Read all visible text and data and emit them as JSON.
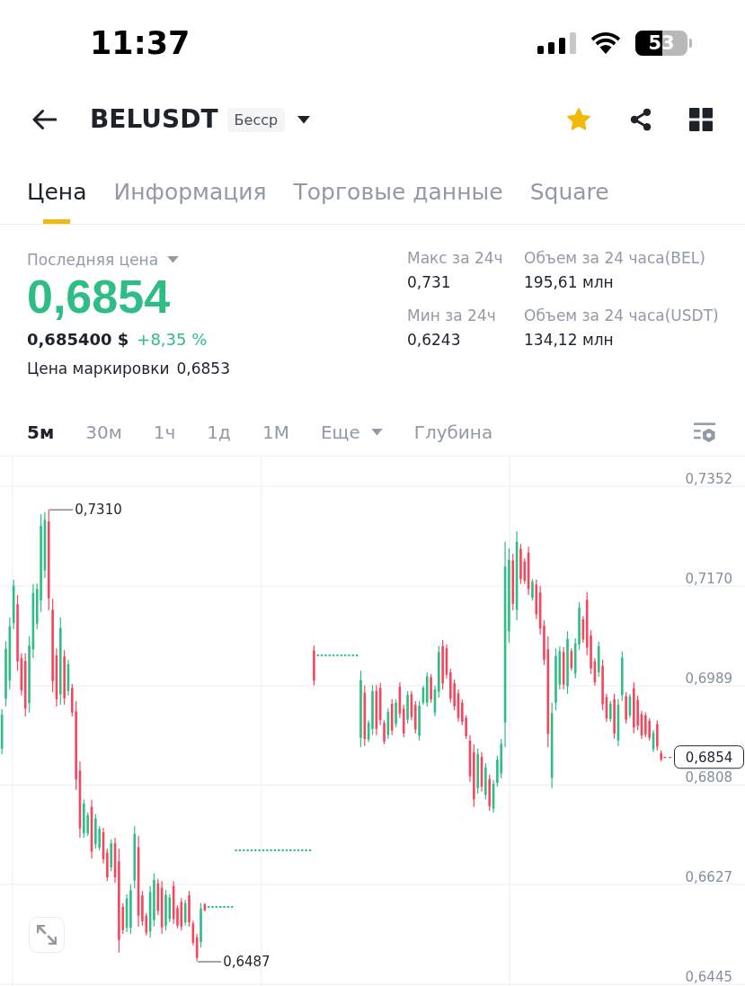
{
  "status_bar": {
    "time": "11:37",
    "battery": "53"
  },
  "header": {
    "title": "BELUSDT",
    "badge": "Бесср",
    "favorite": true
  },
  "tabs": [
    {
      "label": "Цена",
      "selected": true
    },
    {
      "label": "Информация",
      "selected": false
    },
    {
      "label": "Торговые данные",
      "selected": false
    },
    {
      "label": "Square",
      "selected": false
    }
  ],
  "price": {
    "label": "Последняя цена",
    "last": "0,6854",
    "usd": "0,685400 $",
    "change": "+8,35 %",
    "mark_label": "Цена маркировки",
    "mark_value": "0,6853"
  },
  "stats": [
    {
      "label": "Макс за 24ч",
      "value": "0,731"
    },
    {
      "label": "Объем за 24 часа(BEL)",
      "value": "195,61 млн"
    },
    {
      "label": "Мин за 24ч",
      "value": "0,6243"
    },
    {
      "label": "Объем за 24 часа(USDT)",
      "value": "134,12 млн"
    }
  ],
  "intervals": [
    {
      "label": "5м",
      "selected": true,
      "kind": "interval"
    },
    {
      "label": "30м",
      "selected": false,
      "kind": "interval"
    },
    {
      "label": "1ч",
      "selected": false,
      "kind": "interval"
    },
    {
      "label": "1д",
      "selected": false,
      "kind": "interval"
    },
    {
      "label": "1М",
      "selected": false,
      "kind": "interval"
    },
    {
      "label": "Еще",
      "selected": false,
      "kind": "dropdown"
    },
    {
      "label": "Глубина",
      "selected": false,
      "kind": "interval"
    }
  ],
  "chart": {
    "high_marker": "0,7310",
    "low_marker": "0,6487",
    "current_price": "0,6854",
    "chart_data": {
      "type": "candlestick",
      "grid": true,
      "ylim": [
        0.6442,
        0.7406
      ],
      "yticks": [
        {
          "value": 0.7352,
          "label": "0,7352"
        },
        {
          "value": 0.717,
          "label": "0,7170"
        },
        {
          "value": 0.6989,
          "label": "0,6989"
        },
        {
          "value": 0.6808,
          "label": "0,6808"
        },
        {
          "value": 0.6627,
          "label": "0,6627"
        },
        {
          "value": 0.6445,
          "label": "0,6445"
        }
      ],
      "categories": [
        null,
        null,
        null,
        null,
        null,
        null,
        null,
        null,
        null,
        null,
        null,
        null,
        null,
        null,
        null,
        null,
        null,
        null,
        null,
        null,
        null,
        null,
        null,
        null,
        null,
        null,
        null,
        null,
        null,
        null,
        null,
        null,
        null,
        null,
        null,
        null,
        null,
        null,
        null,
        null,
        null,
        null,
        null,
        null,
        null,
        null,
        null,
        null,
        null,
        null,
        null,
        null,
        null,
        null,
        null,
        null,
        null,
        null,
        null,
        null,
        null,
        null,
        null,
        null,
        null,
        null,
        null,
        null,
        null,
        null,
        null,
        null,
        null,
        null,
        null,
        null,
        null,
        null,
        null,
        null,
        null,
        null,
        null,
        null,
        null,
        null,
        null,
        null,
        null,
        null,
        null,
        null,
        null,
        null,
        null,
        null,
        null,
        null,
        null,
        null,
        null,
        null,
        null,
        null,
        null,
        null,
        null,
        null,
        null,
        null,
        null,
        null,
        null,
        null,
        null,
        null,
        null,
        null,
        null,
        null,
        null,
        null,
        null,
        null,
        null,
        null,
        null,
        null,
        null,
        null,
        null,
        null,
        null,
        null,
        null,
        null,
        null,
        null,
        null,
        null,
        null,
        null,
        null,
        null,
        null,
        null,
        null,
        null,
        null,
        null,
        null,
        null,
        null,
        null,
        null,
        null,
        null,
        null,
        null,
        null,
        null,
        null,
        null,
        null,
        null,
        null,
        null,
        null,
        null,
        null,
        null,
        null,
        null,
        null,
        null,
        null,
        null,
        null,
        null,
        null,
        null,
        null,
        null,
        null,
        null,
        null,
        null,
        null,
        null,
        null,
        null
      ],
      "ohlc": [
        [
          0.6874,
          0.6946,
          0.6864,
          0.6936
        ],
        [
          0.6965,
          0.707,
          0.6951,
          0.7056
        ],
        [
          0.6998,
          0.7113,
          0.6982,
          0.7097
        ],
        [
          0.7103,
          0.7182,
          0.7092,
          0.7171
        ],
        [
          0.7137,
          0.7154,
          0.7016,
          0.7033
        ],
        [
          0.7039,
          0.7048,
          0.6971,
          0.698
        ],
        [
          0.7034,
          0.7048,
          0.6933,
          0.6947
        ],
        [
          0.6957,
          0.7079,
          0.694,
          0.7062
        ],
        [
          0.7055,
          0.7174,
          0.7039,
          0.7158
        ],
        [
          0.7102,
          0.7175,
          0.7092,
          0.7165
        ],
        [
          0.7144,
          0.7301,
          0.7123,
          0.728
        ],
        [
          0.7199,
          0.7305,
          0.7185,
          0.7291
        ],
        [
          0.7288,
          0.731,
          0.7126,
          0.7148
        ],
        [
          0.7127,
          0.7147,
          0.6977,
          0.6997
        ],
        [
          0.7044,
          0.7057,
          0.6951,
          0.6964
        ],
        [
          0.6973,
          0.7113,
          0.6954,
          0.7094
        ],
        [
          0.7042,
          0.7054,
          0.6954,
          0.6966
        ],
        [
          0.6979,
          0.7036,
          0.6971,
          0.7028
        ],
        [
          0.6985,
          0.6992,
          0.6933,
          0.694
        ],
        [
          0.6942,
          0.6961,
          0.6799,
          0.6818
        ],
        [
          0.6834,
          0.6851,
          0.6712,
          0.6729
        ],
        [
          0.672,
          0.6782,
          0.6712,
          0.6774
        ],
        [
          0.672,
          0.6758,
          0.6715,
          0.6753
        ],
        [
          0.6768,
          0.6781,
          0.6674,
          0.6687
        ],
        [
          0.67,
          0.6755,
          0.6692,
          0.6747
        ],
        [
          0.6694,
          0.6733,
          0.6689,
          0.6728
        ],
        [
          0.6722,
          0.673,
          0.6665,
          0.6673
        ],
        [
          0.6685,
          0.6692,
          0.6633,
          0.664
        ],
        [
          0.6658,
          0.6709,
          0.6651,
          0.6702
        ],
        [
          0.6702,
          0.6712,
          0.663,
          0.664
        ],
        [
          0.6669,
          0.6692,
          0.6503,
          0.6526
        ],
        [
          0.6586,
          0.6593,
          0.6537,
          0.6544
        ],
        [
          0.6548,
          0.6609,
          0.654,
          0.6601
        ],
        [
          0.6548,
          0.6627,
          0.6537,
          0.6616
        ],
        [
          0.6634,
          0.6733,
          0.662,
          0.6719
        ],
        [
          0.6695,
          0.6715,
          0.655,
          0.657
        ],
        [
          0.6607,
          0.6615,
          0.6552,
          0.656
        ],
        [
          0.657,
          0.6575,
          0.6534,
          0.6539
        ],
        [
          0.6541,
          0.6624,
          0.653,
          0.6613
        ],
        [
          0.6562,
          0.6647,
          0.655,
          0.6635
        ],
        [
          0.6629,
          0.6637,
          0.6571,
          0.6579
        ],
        [
          0.6621,
          0.6633,
          0.6537,
          0.6549
        ],
        [
          0.6552,
          0.6617,
          0.6543,
          0.6608
        ],
        [
          0.6564,
          0.6609,
          0.6558,
          0.6603
        ],
        [
          0.6624,
          0.6633,
          0.6555,
          0.6564
        ],
        [
          0.6584,
          0.6589,
          0.6547,
          0.6552
        ],
        [
          0.6595,
          0.6602,
          0.6543,
          0.655
        ],
        [
          0.6558,
          0.6599,
          0.6552,
          0.6593
        ],
        [
          0.6607,
          0.6615,
          0.655,
          0.6558
        ],
        [
          0.6556,
          0.6561,
          0.6516,
          0.6521
        ],
        [
          0.6531,
          0.6537,
          0.6487,
          0.6493
        ],
        [
          0.6522,
          0.6593,
          0.6512,
          0.6583
        ],
        [
          0.6591,
          0.6593,
          0.6578,
          0.658
        ],
        [
          0.6586,
          0.6586,
          0.6586,
          0.6586
        ],
        [
          0.6586,
          0.6586,
          0.6586,
          0.6586
        ],
        [
          0.6586,
          0.6586,
          0.6586,
          0.6586
        ],
        [
          0.6586,
          0.6586,
          0.6586,
          0.6586
        ],
        [
          0.6586,
          0.6586,
          0.6586,
          0.6586
        ],
        [
          0.6586,
          0.6586,
          0.6586,
          0.6586
        ],
        [
          0.6586,
          0.6586,
          0.6586,
          0.6586
        ],
        [
          0.6689,
          0.6689,
          0.6689,
          0.6689
        ],
        [
          0.6689,
          0.6689,
          0.6689,
          0.6689
        ],
        [
          0.6689,
          0.6689,
          0.6689,
          0.6689
        ],
        [
          0.6689,
          0.6689,
          0.6689,
          0.6689
        ],
        [
          0.6689,
          0.6689,
          0.6689,
          0.6689
        ],
        [
          0.6689,
          0.6689,
          0.6689,
          0.6689
        ],
        [
          0.6689,
          0.6689,
          0.6689,
          0.6689
        ],
        [
          0.6689,
          0.6689,
          0.6689,
          0.6689
        ],
        [
          0.6689,
          0.6689,
          0.6689,
          0.6689
        ],
        [
          0.6689,
          0.6689,
          0.6689,
          0.6689
        ],
        [
          0.6689,
          0.6689,
          0.6689,
          0.6689
        ],
        [
          0.6689,
          0.6689,
          0.6689,
          0.6689
        ],
        [
          0.6689,
          0.6689,
          0.6689,
          0.6689
        ],
        [
          0.6689,
          0.6689,
          0.6689,
          0.6689
        ],
        [
          0.6689,
          0.6689,
          0.6689,
          0.6689
        ],
        [
          0.6689,
          0.6689,
          0.6689,
          0.6689
        ],
        [
          0.6689,
          0.6689,
          0.6689,
          0.6689
        ],
        [
          0.6689,
          0.6689,
          0.6689,
          0.6689
        ],
        [
          0.6689,
          0.6689,
          0.6689,
          0.6689
        ],
        [
          0.6689,
          0.6689,
          0.6689,
          0.6689
        ],
        [
          0.7053,
          0.7062,
          0.6989,
          0.6998
        ],
        [
          0.7044,
          0.7044,
          0.7044,
          0.7044
        ],
        [
          0.7044,
          0.7044,
          0.7044,
          0.7044
        ],
        [
          0.7044,
          0.7044,
          0.7044,
          0.7044
        ],
        [
          0.7044,
          0.7044,
          0.7044,
          0.7044
        ],
        [
          0.7044,
          0.7044,
          0.7044,
          0.7044
        ],
        [
          0.7044,
          0.7044,
          0.7044,
          0.7044
        ],
        [
          0.7044,
          0.7044,
          0.7044,
          0.7044
        ],
        [
          0.7044,
          0.7044,
          0.7044,
          0.7044
        ],
        [
          0.7044,
          0.7044,
          0.7044,
          0.7044
        ],
        [
          0.7044,
          0.7044,
          0.7044,
          0.7044
        ],
        [
          0.7044,
          0.7044,
          0.7044,
          0.7044
        ],
        [
          0.6894,
          0.7016,
          0.6877,
          0.6999
        ],
        [
          0.6976,
          0.6989,
          0.6879,
          0.6892
        ],
        [
          0.6891,
          0.6926,
          0.6886,
          0.6921
        ],
        [
          0.691,
          0.699,
          0.6899,
          0.6979
        ],
        [
          0.6979,
          0.699,
          0.6899,
          0.691
        ],
        [
          0.6985,
          0.6994,
          0.6917,
          0.6926
        ],
        [
          0.6921,
          0.6926,
          0.6882,
          0.6887
        ],
        [
          0.6899,
          0.6948,
          0.6892,
          0.6941
        ],
        [
          0.6956,
          0.6964,
          0.6899,
          0.6907
        ],
        [
          0.6919,
          0.6964,
          0.6913,
          0.6958
        ],
        [
          0.6987,
          0.6995,
          0.693,
          0.6938
        ],
        [
          0.6947,
          0.6954,
          0.6895,
          0.6902
        ],
        [
          0.6927,
          0.6979,
          0.692,
          0.6972
        ],
        [
          0.6973,
          0.6979,
          0.6926,
          0.6932
        ],
        [
          0.6954,
          0.6961,
          0.6902,
          0.6909
        ],
        [
          0.6898,
          0.6961,
          0.6889,
          0.6952
        ],
        [
          0.6958,
          0.6989,
          0.6954,
          0.6985
        ],
        [
          0.6958,
          0.7013,
          0.6951,
          0.7006
        ],
        [
          0.7004,
          0.701,
          0.6958,
          0.6964
        ],
        [
          0.694,
          0.6989,
          0.6933,
          0.6982
        ],
        [
          0.6978,
          0.7061,
          0.6967,
          0.705
        ],
        [
          0.7061,
          0.7072,
          0.6982,
          0.6993
        ],
        [
          0.7057,
          0.7064,
          0.7002,
          0.7009
        ],
        [
          0.7013,
          0.702,
          0.6958,
          0.6965
        ],
        [
          0.6993,
          0.7,
          0.6944,
          0.6951
        ],
        [
          0.6975,
          0.6982,
          0.6923,
          0.693
        ],
        [
          0.6958,
          0.6964,
          0.6917,
          0.6923
        ],
        [
          0.693,
          0.6935,
          0.6892,
          0.6897
        ],
        [
          0.6889,
          0.6899,
          0.6814,
          0.6824
        ],
        [
          0.6868,
          0.6882,
          0.6768,
          0.6782
        ],
        [
          0.6802,
          0.6874,
          0.6792,
          0.6864
        ],
        [
          0.6859,
          0.6868,
          0.6796,
          0.6805
        ],
        [
          0.679,
          0.6848,
          0.6782,
          0.684
        ],
        [
          0.6819,
          0.6827,
          0.6761,
          0.6769
        ],
        [
          0.6765,
          0.6817,
          0.6758,
          0.681
        ],
        [
          0.6812,
          0.6861,
          0.6805,
          0.6854
        ],
        [
          0.6829,
          0.6892,
          0.682,
          0.6883
        ],
        [
          0.6922,
          0.7251,
          0.6877,
          0.7206
        ],
        [
          0.7088,
          0.7239,
          0.7067,
          0.7218
        ],
        [
          0.7217,
          0.7229,
          0.7126,
          0.7138
        ],
        [
          0.7127,
          0.727,
          0.7108,
          0.7251
        ],
        [
          0.7238,
          0.7247,
          0.7174,
          0.7183
        ],
        [
          0.7215,
          0.7221,
          0.7174,
          0.718
        ],
        [
          0.7231,
          0.7242,
          0.7154,
          0.7165
        ],
        [
          0.7149,
          0.7183,
          0.7144,
          0.7178
        ],
        [
          0.7173,
          0.7182,
          0.711,
          0.7119
        ],
        [
          0.7159,
          0.717,
          0.7082,
          0.7093
        ],
        [
          0.7098,
          0.7108,
          0.7026,
          0.7036
        ],
        [
          0.7055,
          0.7079,
          0.6877,
          0.6901
        ],
        [
          0.6821,
          0.6958,
          0.6802,
          0.6939
        ],
        [
          0.6958,
          0.7057,
          0.6944,
          0.7043
        ],
        [
          0.6991,
          0.7061,
          0.6982,
          0.7052
        ],
        [
          0.705,
          0.7059,
          0.6982,
          0.6991
        ],
        [
          0.6988,
          0.7088,
          0.6974,
          0.7074
        ],
        [
          0.7052,
          0.7057,
          0.7016,
          0.7021
        ],
        [
          0.7011,
          0.7075,
          0.7002,
          0.7066
        ],
        [
          0.7064,
          0.7141,
          0.7054,
          0.7131
        ],
        [
          0.711,
          0.7116,
          0.7067,
          0.7073
        ],
        [
          0.7145,
          0.7159,
          0.7044,
          0.7058
        ],
        [
          0.708,
          0.709,
          0.701,
          0.702
        ],
        [
          0.7033,
          0.7039,
          0.6989,
          0.6995
        ],
        [
          0.7013,
          0.7069,
          0.7005,
          0.7061
        ],
        [
          0.7025,
          0.7036,
          0.6944,
          0.6955
        ],
        [
          0.6968,
          0.6974,
          0.6923,
          0.6929
        ],
        [
          0.6928,
          0.6961,
          0.6923,
          0.6956
        ],
        [
          0.6964,
          0.6974,
          0.6892,
          0.6902
        ],
        [
          0.6889,
          0.6964,
          0.6879,
          0.6954
        ],
        [
          0.6972,
          0.7051,
          0.6961,
          0.704
        ],
        [
          0.697,
          0.6977,
          0.692,
          0.6927
        ],
        [
          0.6935,
          0.6974,
          0.693,
          0.6969
        ],
        [
          0.6984,
          0.6995,
          0.6902,
          0.6913
        ],
        [
          0.6963,
          0.6971,
          0.6908,
          0.6916
        ],
        [
          0.6937,
          0.6943,
          0.6892,
          0.6898
        ],
        [
          0.6935,
          0.694,
          0.6895,
          0.69
        ],
        [
          0.6925,
          0.693,
          0.6889,
          0.6894
        ],
        [
          0.6873,
          0.6908,
          0.6868,
          0.6903
        ],
        [
          0.6919,
          0.6926,
          0.6871,
          0.6878
        ],
        [
          0.6866,
          0.6871,
          0.6851,
          0.6854
        ],
        null,
        null,
        null,
        null,
        null,
        null,
        null,
        null,
        null,
        null,
        null,
        null,
        null,
        null,
        null,
        null,
        null,
        null,
        null,
        null,
        null
      ]
    }
  }
}
